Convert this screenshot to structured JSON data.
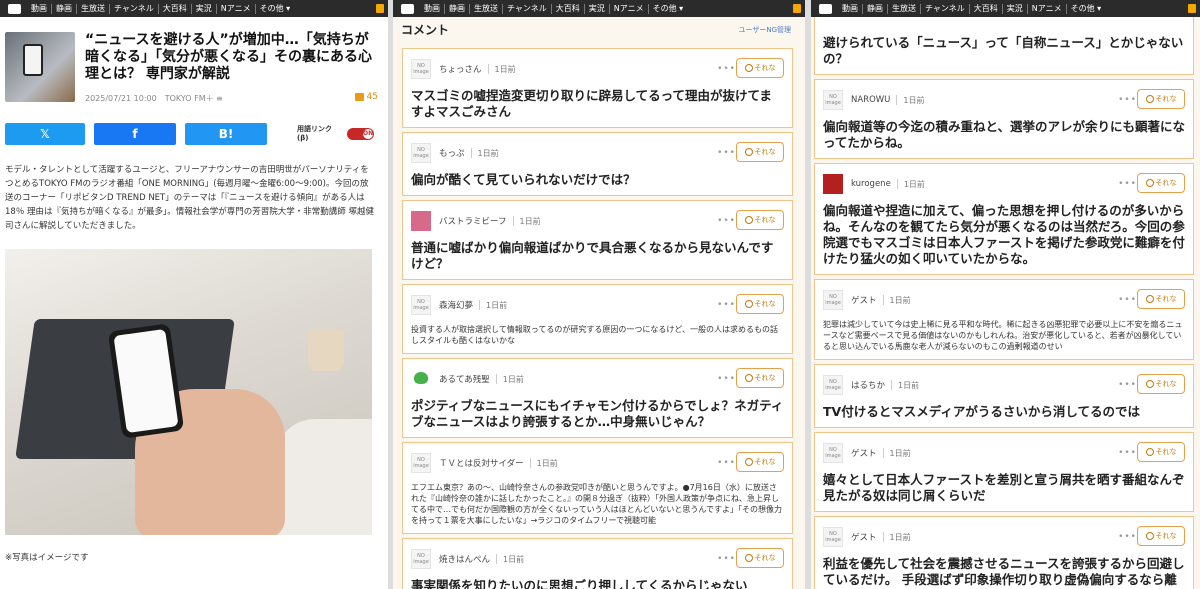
{
  "nav": [
    "動画",
    "静画",
    "生放送",
    "チャンネル",
    "大百科",
    "実況",
    "Nアニメ",
    "その他 ▾"
  ],
  "article": {
    "title": "“ニュースを避ける人”が増加中…「気持ちが暗くなる」「気分が悪くなる」その裏にある心理とは？ 専門家が解説",
    "meta": "2025/07/21 10:00　TOKYO FM＋ ≡",
    "comment_count": "45",
    "share": {
      "twitter": "𝕏",
      "facebook": "f",
      "bi": "B!"
    },
    "term_link": "用語リンク(β)",
    "toggle_label": "ON",
    "body": "モデル・タレントとして活躍するユージと、フリーアナウンサーの吉田明世がパーソナリティをつとめるTOKYO FMのラジオ番組「ONE MORNING」(毎週月曜～金曜6:00～9:00)。今回の放送のコーナー「リポビタンD TREND NET」のテーマは「『ニュースを避ける傾向』がある人は18％ 理由は『気持ちが暗くなる』が最多」。情報社会学が専門の芳習院大学・非常勤講師 塚越健司さんに解説していただきました。",
    "caption": "※写真はイメージです"
  },
  "comments_panel": {
    "title": "コメント",
    "ng_setting": "ユーザーNG管理",
    "button_label": "それな",
    "more": "•••",
    "items": [
      {
        "user": "ちょっさん",
        "time": "1日前",
        "avatar": "NO image",
        "text": "マスゴミの嘘捏造変更切り取りに辟易してるって理由が抜けてますよマスごみさん",
        "size": "big"
      },
      {
        "user": "もっぷ",
        "time": "1日前",
        "avatar": "NO image",
        "text": "偏向が酷くて見ていられないだけでは？",
        "size": "big"
      },
      {
        "user": "バストラミビーフ",
        "time": "1日前",
        "avatar": "pink",
        "text": "普通に嘘ばかり偏向報道ばかりで具合悪くなるから見ないんですけど？",
        "size": "big"
      },
      {
        "user": "森海幻夢",
        "time": "1日前",
        "avatar": "NO image",
        "text": "投資する人が取捨選択して情報取ってるのが研究する原因の一つになるけど、一般の人は求めるもの話しスタイルも酷くはないかな",
        "size": "small"
      },
      {
        "user": "あるてあ残聖",
        "time": "1日前",
        "avatar": "green",
        "text": "ポジティブなニュースにもイチャモン付けるからでしょ？ネガティブなニュースはより誇張するとか…中身無いじゃん？",
        "size": "big"
      },
      {
        "user": "ＴＶとは反対サイダー",
        "time": "1日前",
        "avatar": "NO image",
        "text": "エフエム東京？あの～、山崎怜奈さんの参政党叩きが酷いと思うんですよ。●7月16日（水）に放送された『山崎怜奈の誰かに話したかったこと。』の開８分過ぎ（抜粋）「外国人政策が争点にね、急上昇してる中で…でも何だか国際観の方が全くないっていう人はほとんどいないと思うんですよ」「その想像力を持って１票を大事にしたいな」→ラジコのタイムフリーで視聴可能",
        "size": "small"
      },
      {
        "user": "焼きはんぺん",
        "time": "1日前",
        "avatar": "NO image",
        "text": "事実関係を知りたいのに思想ごり押ししてくるからじゃない",
        "size": "big"
      }
    ],
    "items_right": [
      {
        "user": "",
        "time": "",
        "avatar": "",
        "text": "避けられている「ニュース」って「自称ニュース」とかじゃないの？",
        "size": "big",
        "cont": true
      },
      {
        "user": "NAROWU",
        "time": "1日前",
        "avatar": "NO image",
        "text": "偏向報道等の今迄の積み重ねと、選挙のアレが余りにも顕著になってたからね。",
        "size": "big"
      },
      {
        "user": "kurogene",
        "time": "1日前",
        "avatar": "red",
        "text": "偏向報道や捏造に加えて、偏った思想を押し付けるのが多いからね。そんなのを観てたら気分が悪くなるのは当然だろ。今回の参院選でもマスゴミは日本人ファーストを掲げた参政党に難癖を付けたり猛火の如く叩いていたからな。",
        "size": "big"
      },
      {
        "user": "ゲスト",
        "time": "1日前",
        "avatar": "NO image",
        "text": "犯罪は減少していて今は史上稀に見る平和な時代。稀に起きる凶悪犯罪で必要以上に不安を煽るニュースなど需要ベースで見る価値はないのかもしれんね。治安が悪化していると、若者が凶暴化していると思い込んでいる馬鹿な老人が減らないのもこの過剰報道のせい",
        "size": "small"
      },
      {
        "user": "はるちか",
        "time": "1日前",
        "avatar": "NO image",
        "text": "TV付けるとマスメディアがうるさいから消してるのでは",
        "size": "big"
      },
      {
        "user": "ゲスト",
        "time": "1日前",
        "avatar": "NO image",
        "text": "嬉々として日本人ファーストを差別と宣う屑共を晒す番組なんぞ見たがる奴は同じ屑くらいだ",
        "size": "big"
      },
      {
        "user": "ゲスト",
        "time": "1日前",
        "avatar": "NO image",
        "text": "利益を優先して社会を震撼させるニュースを誇張するから回避しているだけ。 手段選ばず印象操作切り取り虚偽偏向するなら離れて行くさ。",
        "size": "big"
      }
    ]
  },
  "colors": {
    "accent": "#e89b17",
    "border": "#f2c58a",
    "twitter": "#1d9bf0",
    "facebook": "#1877f2"
  }
}
